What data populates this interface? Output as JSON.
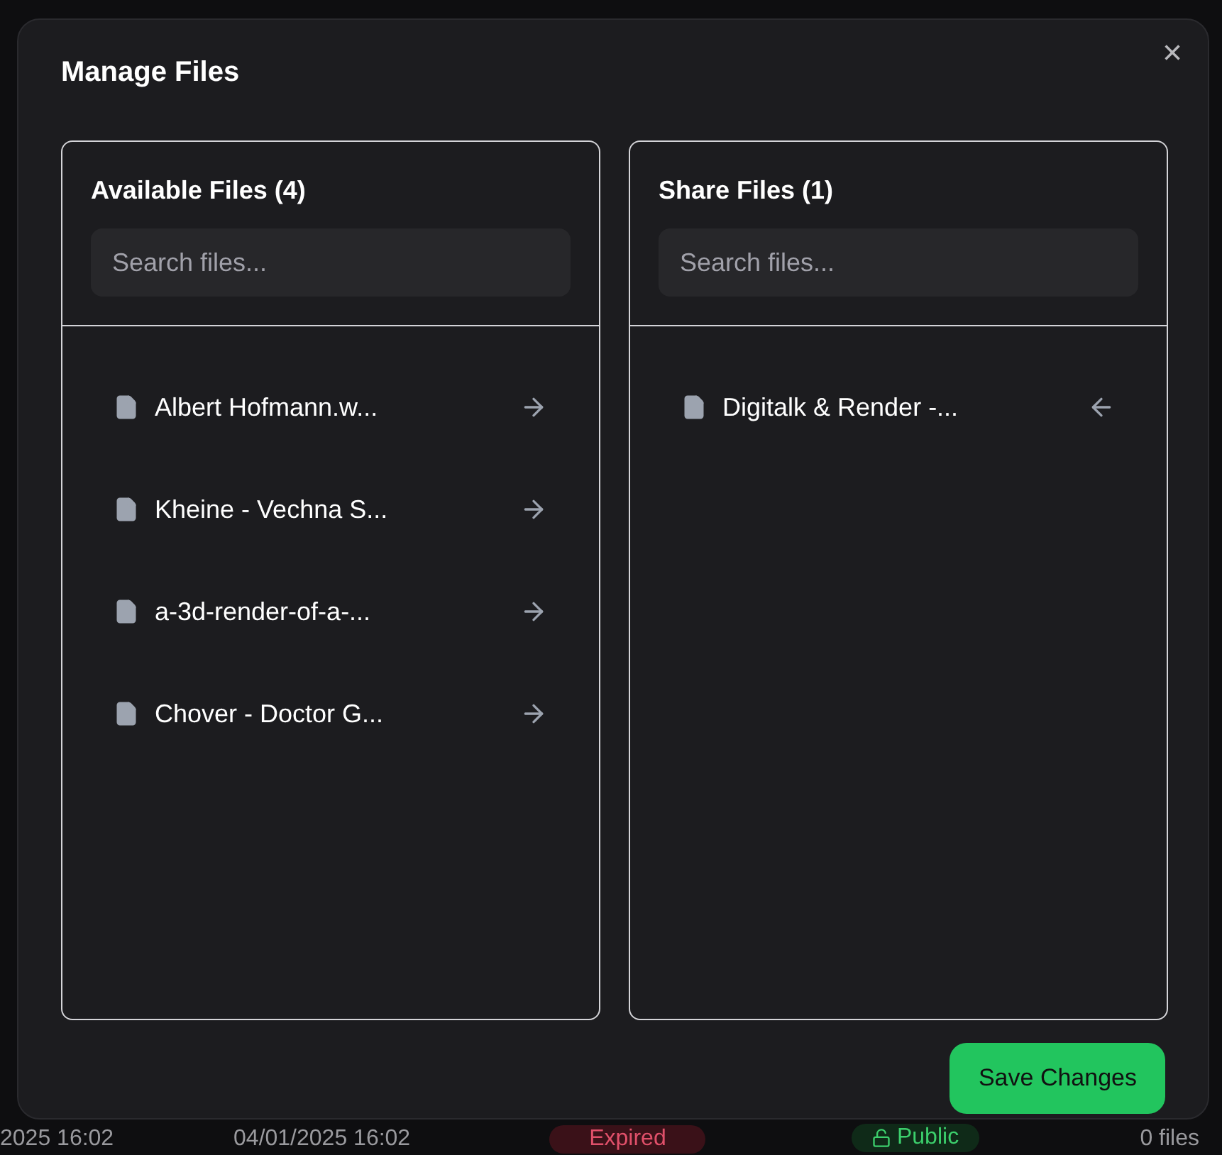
{
  "background": {
    "bottom_row": [
      "2025 16:02",
      "04/01/2025 16:02",
      "Expired",
      "Public",
      "0 files"
    ]
  },
  "dialog": {
    "title": "Manage Files",
    "close": "×",
    "panels": [
      {
        "title": "Available Files (4)",
        "placeholder": "Search files...",
        "kind": "available",
        "files": [
          "Albert Hofmann.w...",
          "Kheine - Vechna S...",
          "a-3d-render-of-a-...",
          "Chover - Doctor G..."
        ]
      },
      {
        "title": "Share Files (1)",
        "placeholder": "Search files...",
        "kind": "shared",
        "files": [
          "Digitalk & Render -..."
        ]
      }
    ],
    "save_button": "Save Changes"
  }
}
